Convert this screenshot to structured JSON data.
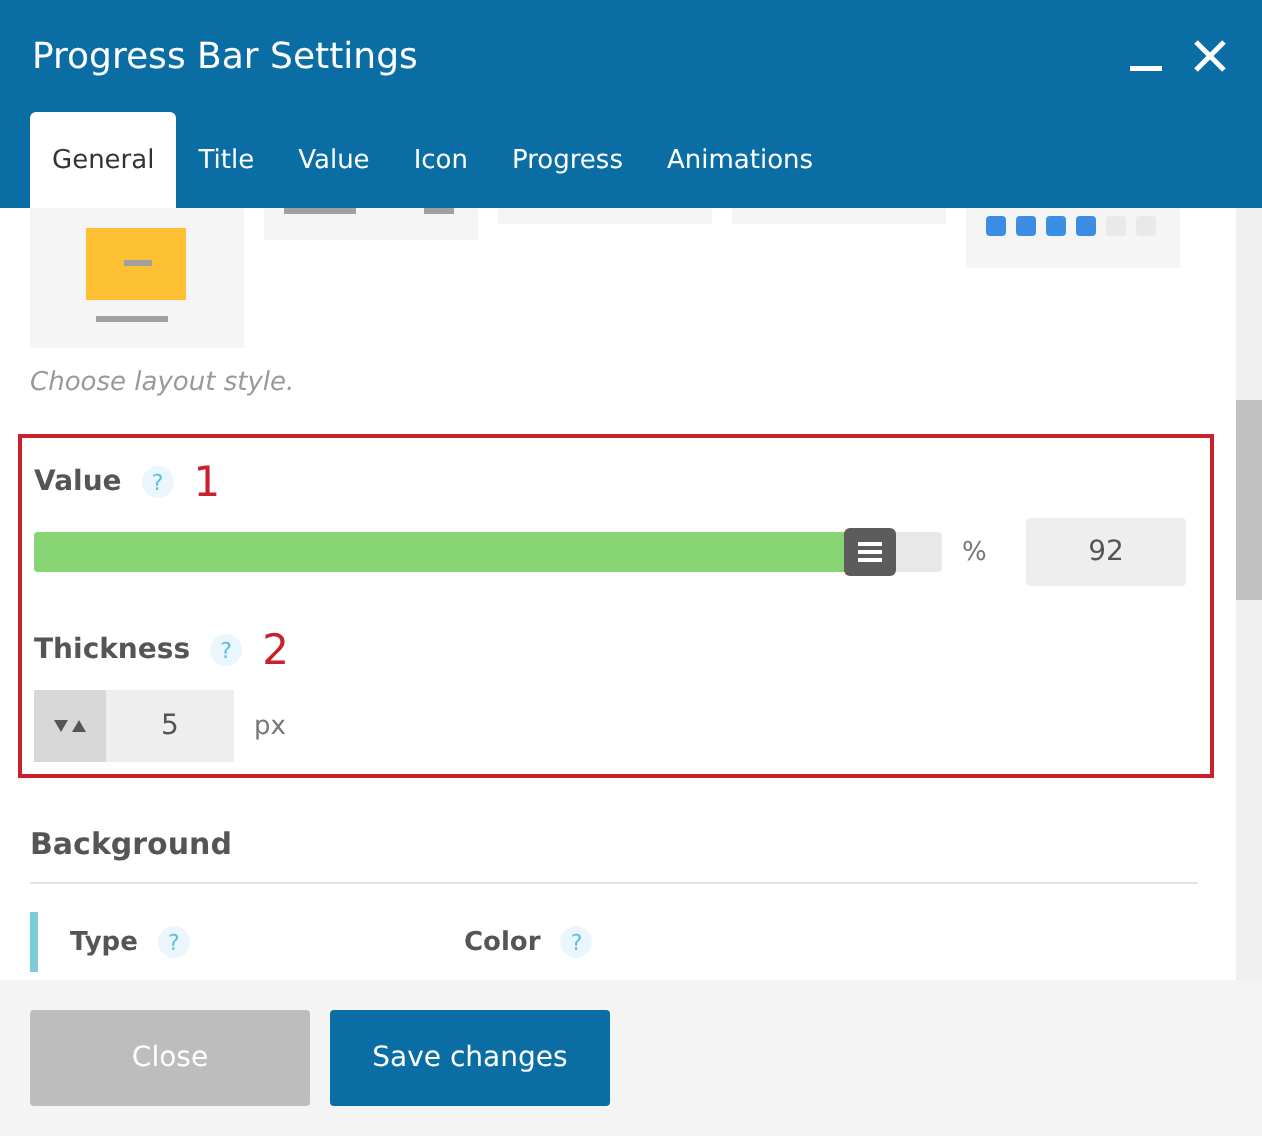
{
  "window": {
    "title": "Progress Bar Settings"
  },
  "tabs": [
    {
      "label": "General",
      "selected": true
    },
    {
      "label": "Title",
      "selected": false
    },
    {
      "label": "Value",
      "selected": false
    },
    {
      "label": "Icon",
      "selected": false
    },
    {
      "label": "Progress",
      "selected": false
    },
    {
      "label": "Animations",
      "selected": false
    }
  ],
  "layout_hint": "Choose layout style.",
  "value_field": {
    "label": "Value",
    "help": "?",
    "marker": "1",
    "level": 0.92,
    "unit": "%",
    "value": "92"
  },
  "thickness_field": {
    "label": "Thickness",
    "help": "?",
    "marker": "2",
    "value": "5",
    "unit": "px"
  },
  "background": {
    "heading": "Background",
    "fields": [
      {
        "label": "Type",
        "help": "?"
      },
      {
        "label": "Color",
        "help": "?"
      }
    ]
  },
  "buttons": [
    {
      "label": "Close",
      "kind": "secondary"
    },
    {
      "label": "Save changes",
      "kind": "primary"
    }
  ]
}
